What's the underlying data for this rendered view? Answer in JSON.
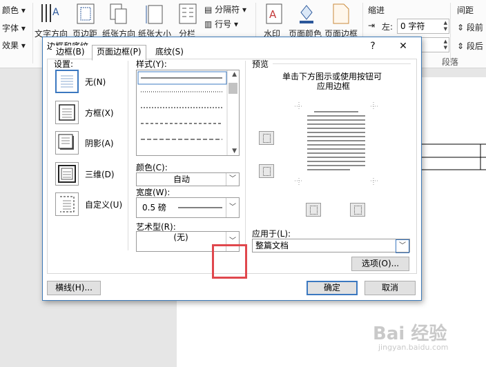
{
  "ribbon": {
    "font_group": {
      "color": "颜色",
      "font": "字体",
      "effects": "效果"
    },
    "page_setup": {
      "text_direction": "文字方向",
      "margins": "页边距",
      "orientation": "纸张方向",
      "size": "纸张大小",
      "columns": "分栏",
      "breaks": "分隔符",
      "line_numbers": "行号"
    },
    "page_background": {
      "watermark": "水印",
      "page_color": "页面颜色",
      "page_borders": "页面边框"
    },
    "paragraph": {
      "indent": "缩进",
      "left_label": "左:",
      "left_value": "0 字符",
      "spacing": "间距",
      "before": "段前",
      "after": "段后",
      "group_label": "段落"
    }
  },
  "dialog": {
    "title": "边框和底纹",
    "help": "?",
    "close": "✕",
    "tabs": [
      "边框(B)",
      "页面边框(P)",
      "底纹(S)"
    ],
    "settings_label": "设置:",
    "settings": [
      "无(N)",
      "方框(X)",
      "阴影(A)",
      "三维(D)",
      "自定义(U)"
    ],
    "style_label": "样式(Y):",
    "color_label": "颜色(C):",
    "color_value": "自动",
    "width_label": "宽度(W):",
    "width_value": "0.5 磅",
    "art_label": "艺术型(R):",
    "art_value": "(无)",
    "preview_label": "预览",
    "preview_hint_1": "单击下方图示或使用按钮可",
    "preview_hint_2": "应用边框",
    "apply_label": "应用于(L):",
    "apply_value": "整篇文档",
    "options_button": "选项(O)...",
    "hline_button": "横线(H)...",
    "ok_button": "确定",
    "cancel_button": "取消"
  },
  "watermark": {
    "logo": "Bai 经验",
    "url": "jingyan.baidu.com"
  }
}
